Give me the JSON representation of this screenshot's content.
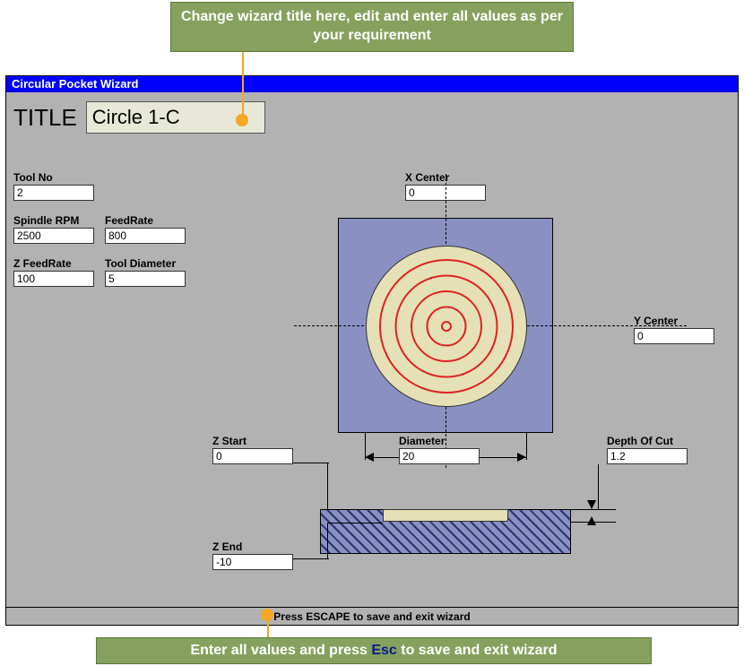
{
  "annotations": {
    "top": "Change wizard title here, edit and enter all values as per your requirement",
    "bottom_pre": "Enter all values and press ",
    "bottom_key": "Esc",
    "bottom_post": " to save and exit wizard"
  },
  "window": {
    "title": "Circular Pocket Wizard",
    "footer": "Press ESCAPE to save and exit wizard"
  },
  "title_section": {
    "label": "TITLE",
    "value": "Circle 1-C"
  },
  "fields": {
    "tool_no": {
      "label": "Tool No",
      "value": "2"
    },
    "spindle_rpm": {
      "label": "Spindle RPM",
      "value": "2500"
    },
    "feedrate": {
      "label": "FeedRate",
      "value": "800"
    },
    "z_feedrate": {
      "label": "Z FeedRate",
      "value": "100"
    },
    "tool_diameter": {
      "label": "Tool Diameter",
      "value": "5"
    },
    "x_center": {
      "label": "X Center",
      "value": "0"
    },
    "y_center": {
      "label": "Y Center",
      "value": "0"
    },
    "z_start": {
      "label": "Z Start",
      "value": "0"
    },
    "z_end": {
      "label": "Z End",
      "value": "-10"
    },
    "diameter": {
      "label": "Diameter",
      "value": "20"
    },
    "depth_of_cut": {
      "label": "Depth Of Cut",
      "value": "1.2"
    }
  }
}
